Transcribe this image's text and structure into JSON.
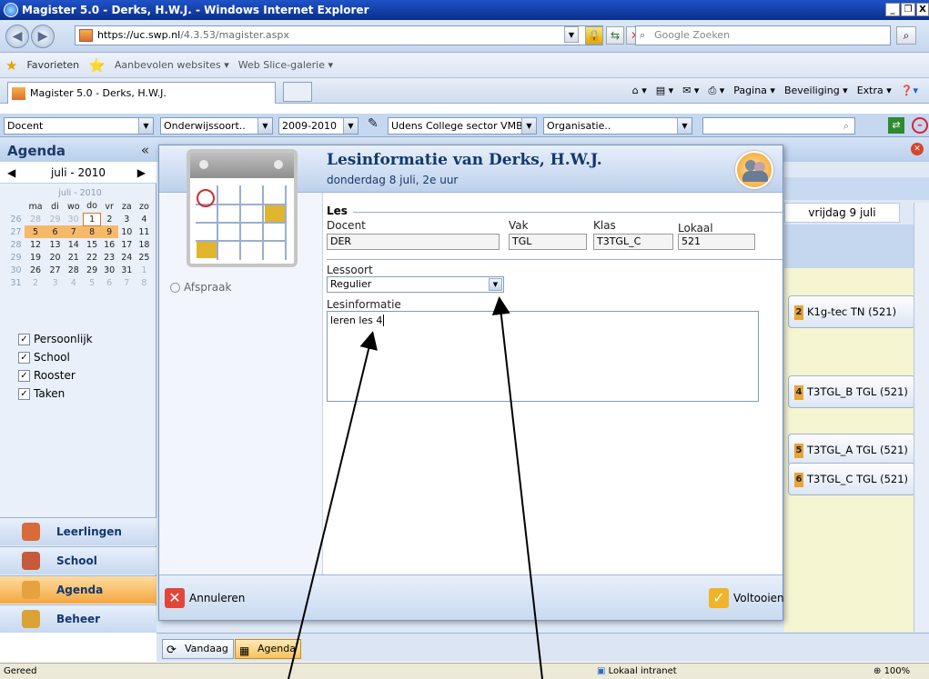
{
  "window": {
    "title": "Magister 5.0 - Derks, H.W.J. - Windows Internet Explorer"
  },
  "address": {
    "host": "https://uc.swp.nl",
    "path": "/4.3.53/magister.aspx",
    "search_placeholder": "Google Zoeken"
  },
  "favorites": {
    "label": "Favorieten",
    "items": [
      "Aanbevolen websites ▾",
      "Web Slice-galerie ▾"
    ]
  },
  "tab": {
    "label": "Magister 5.0 - Derks, H.W.J."
  },
  "commandbar": {
    "pagina": "Pagina ▾",
    "beveiliging": "Beveiliging ▾",
    "extra": "Extra ▾"
  },
  "toolbar": {
    "role": "Docent",
    "type": "Onderwijssoort..",
    "year": "2009-2010",
    "school": "Udens College sector VMBO",
    "org": "Organisatie.."
  },
  "sidebar": {
    "title": "Agenda",
    "collapse": "«",
    "month_nav": "juli - 2010",
    "cal_caption": "juli - 2010",
    "days": [
      "ma",
      "di",
      "wo",
      "do",
      "vr",
      "za",
      "zo"
    ],
    "weeks": [
      {
        "wk": "26",
        "d": [
          "28",
          "29",
          "30",
          "1",
          "2",
          "3",
          "4"
        ]
      },
      {
        "wk": "27",
        "d": [
          "5",
          "6",
          "7",
          "8",
          "9",
          "10",
          "11"
        ]
      },
      {
        "wk": "28",
        "d": [
          "12",
          "13",
          "14",
          "15",
          "16",
          "17",
          "18"
        ]
      },
      {
        "wk": "29",
        "d": [
          "19",
          "20",
          "21",
          "22",
          "23",
          "24",
          "25"
        ]
      },
      {
        "wk": "30",
        "d": [
          "26",
          "27",
          "28",
          "29",
          "30",
          "31",
          "1"
        ]
      },
      {
        "wk": "31",
        "d": [
          "2",
          "3",
          "4",
          "5",
          "6",
          "7",
          "8"
        ]
      }
    ],
    "filters": [
      "Persoonlijk",
      "School",
      "Rooster",
      "Taken"
    ],
    "panels": [
      "Leerlingen",
      "School",
      "Agenda",
      "Beheer"
    ]
  },
  "main": {
    "day_header": "vrijdag 9 juli",
    "appointments": [
      {
        "num": "2",
        "text": "K1g-tec TN (521)"
      },
      {
        "num": "4",
        "text": "T3TGL_B TGL (521)"
      },
      {
        "num": "5",
        "text": "T3TGL_A TGL (521)"
      },
      {
        "num": "6",
        "text": "T3TGL_C TGL (521)"
      }
    ]
  },
  "dialog": {
    "title": "Lesinformatie van Derks, H.W.J.",
    "subtitle": "donderdag 8 juli, 2e uur",
    "afspraak": "Afspraak",
    "section_les": "Les",
    "labels": {
      "docent": "Docent",
      "vak": "Vak",
      "klas": "Klas",
      "lokaal": "Lokaal",
      "lessoort": "Lessoort",
      "info": "Lesinformatie"
    },
    "values": {
      "docent": "DER",
      "vak": "TGL",
      "klas": "T3TGL_C",
      "lokaal": "521",
      "lessoort": "Regulier",
      "info": "leren les 4"
    },
    "cancel": "Annuleren",
    "finish": "Voltooien"
  },
  "bottom": {
    "today": "Vandaag",
    "agenda": "Agenda"
  },
  "status": {
    "left": "Gereed",
    "zone": "Lokaal intranet",
    "zoom": "100%"
  }
}
